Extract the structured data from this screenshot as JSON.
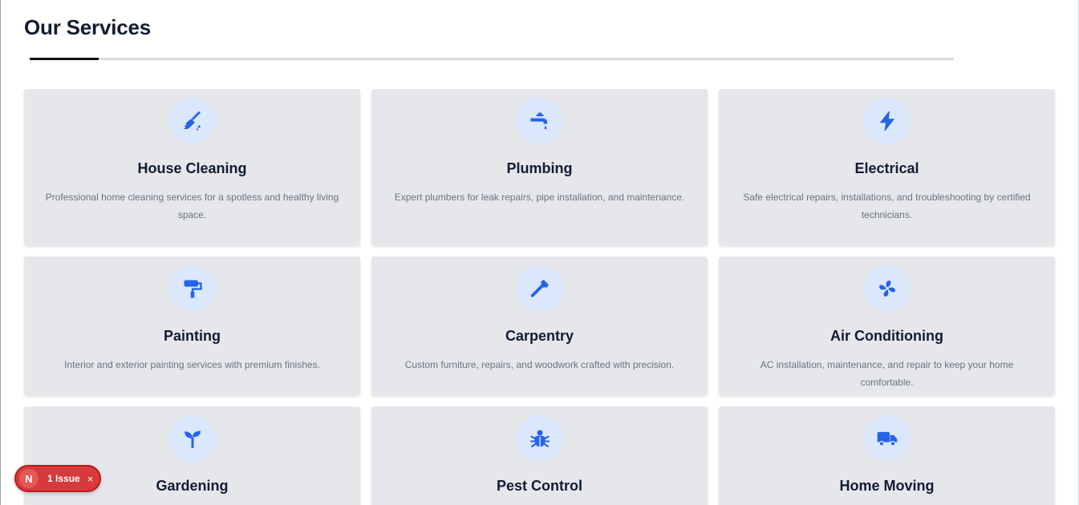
{
  "section": {
    "title": "Our Services"
  },
  "accent_color": "#2563eb",
  "services": [
    {
      "title": "House Cleaning",
      "description": "Professional home cleaning services for a spotless and healthy living space.",
      "icon": "broom-icon"
    },
    {
      "title": "Plumbing",
      "description": "Expert plumbers for leak repairs, pipe installation, and maintenance.",
      "icon": "faucet-icon"
    },
    {
      "title": "Electrical",
      "description": "Safe electrical repairs, installations, and troubleshooting by certified technicians.",
      "icon": "bolt-icon"
    },
    {
      "title": "Painting",
      "description": "Interior and exterior painting services with premium finishes.",
      "icon": "paint-roller-icon"
    },
    {
      "title": "Carpentry",
      "description": "Custom furniture, repairs, and woodwork crafted with precision.",
      "icon": "hammer-icon"
    },
    {
      "title": "Air Conditioning",
      "description": "AC installation, maintenance, and repair to keep your home comfortable.",
      "icon": "fan-icon"
    },
    {
      "title": "Gardening",
      "description": "",
      "icon": "seedling-icon"
    },
    {
      "title": "Pest Control",
      "description": "",
      "icon": "bug-icon"
    },
    {
      "title": "Home Moving",
      "description": "",
      "icon": "truck-icon"
    }
  ],
  "issue_badge": {
    "avatar_letter": "N",
    "label": "1 Issue",
    "close": "×"
  }
}
